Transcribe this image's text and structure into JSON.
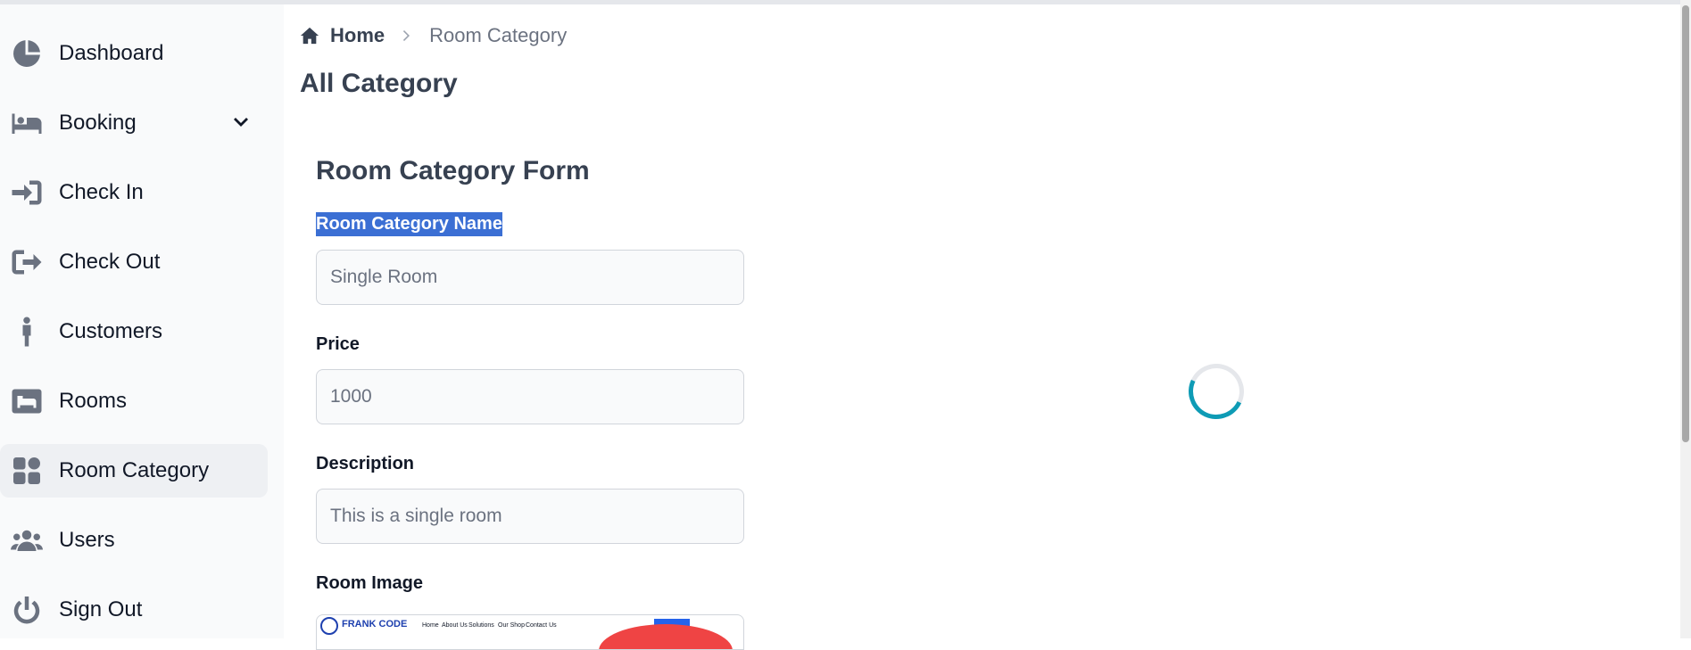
{
  "sidebar": {
    "items": [
      {
        "label": "Dashboard",
        "icon": "pie-chart-icon"
      },
      {
        "label": "Booking",
        "icon": "bed-icon",
        "expandable": true
      },
      {
        "label": "Check In",
        "icon": "sign-in-icon"
      },
      {
        "label": "Check Out",
        "icon": "sign-out-icon"
      },
      {
        "label": "Customers",
        "icon": "person-icon"
      },
      {
        "label": "Rooms",
        "icon": "hotel-icon"
      },
      {
        "label": "Room Category",
        "icon": "grid-icon",
        "active": true
      },
      {
        "label": "Users",
        "icon": "users-icon"
      },
      {
        "label": "Sign Out",
        "icon": "power-icon"
      }
    ]
  },
  "breadcrumb": {
    "home": "Home",
    "current": "Room Category"
  },
  "page": {
    "title": "All Category"
  },
  "form": {
    "title": "Room Category Form",
    "name_label": "Room Category Name",
    "name_value": "Single Room",
    "price_label": "Price",
    "price_value": "1000",
    "description_label": "Description",
    "description_value": "This is a single room",
    "image_label": "Room Image",
    "image_thumb": {
      "logo": "FRANK CODE",
      "nav": [
        "Home",
        "About Us",
        "Solutions",
        "Our Shop",
        "Contact Us"
      ]
    }
  },
  "colors": {
    "sidebar_bg": "#f9fafb",
    "selection": "#3b6fd4",
    "spinner": "#0e9bb5"
  }
}
